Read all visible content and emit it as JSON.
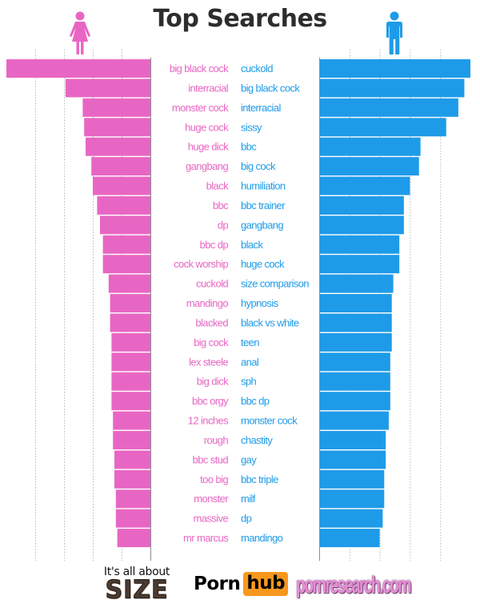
{
  "colors": {
    "female": "#e866c3",
    "male": "#1e9be8",
    "title": "#2d2d2d",
    "gridline": "#b8b8b8",
    "axis": "#999999"
  },
  "icons": {
    "female": "female-person-icon",
    "male": "male-person-icon"
  },
  "chart_data": {
    "type": "bar",
    "orientation": "horizontal-mirrored",
    "title": "Top Searches",
    "xlabel": "",
    "ylabel": "",
    "value_unit": "relative search index (top term = 100)",
    "xlim": [
      0,
      100
    ],
    "gridlines": [
      20,
      40,
      60,
      80
    ],
    "grid": true,
    "legend": "none (female icon top-left, male icon top-right)",
    "series": [
      {
        "name": "Women",
        "side": "left",
        "color": "#e866c3",
        "categories": [
          "big black cock",
          "interracial",
          "monster cock",
          "huge cock",
          "huge dick",
          "gangbang",
          "black",
          "bbc",
          "dp",
          "bbc dp",
          "cock worship",
          "cuckold",
          "mandingo",
          "blacked",
          "big cock",
          "lex steele",
          "big dick",
          "bbc orgy",
          "12 inches",
          "rough",
          "bbc stud",
          "too big",
          "monster",
          "massive",
          "mr marcus"
        ],
        "values": [
          100,
          59,
          47,
          46,
          45,
          41,
          40,
          37,
          35,
          33,
          33,
          29,
          28,
          28,
          27,
          27,
          27,
          27,
          26,
          26,
          25,
          25,
          24,
          24,
          23
        ]
      },
      {
        "name": "Men",
        "side": "right",
        "color": "#1e9be8",
        "categories": [
          "cuckold",
          "big black cock",
          "interracial",
          "sissy",
          "bbc",
          "big cock",
          "humiliation",
          "bbc trainer",
          "gangbang",
          "black",
          "huge cock",
          "size comparison",
          "hypnosis",
          "black vs white",
          "teen",
          "anal",
          "sph",
          "bbc dp",
          "monster cock",
          "chastity",
          "gay",
          "bbc triple",
          "milf",
          "dp",
          "mandingo"
        ],
        "values": [
          100,
          96,
          92,
          84,
          67,
          66,
          60,
          56,
          56,
          53,
          53,
          49,
          48,
          48,
          48,
          47,
          47,
          47,
          46,
          44,
          44,
          43,
          43,
          42,
          40
        ]
      }
    ]
  },
  "footer": {
    "size_tagline": "It's all about",
    "size_word": "SIZE",
    "pornhub_left": "Porn",
    "pornhub_right": "hub",
    "pornresearch": "pornresearch.com"
  }
}
